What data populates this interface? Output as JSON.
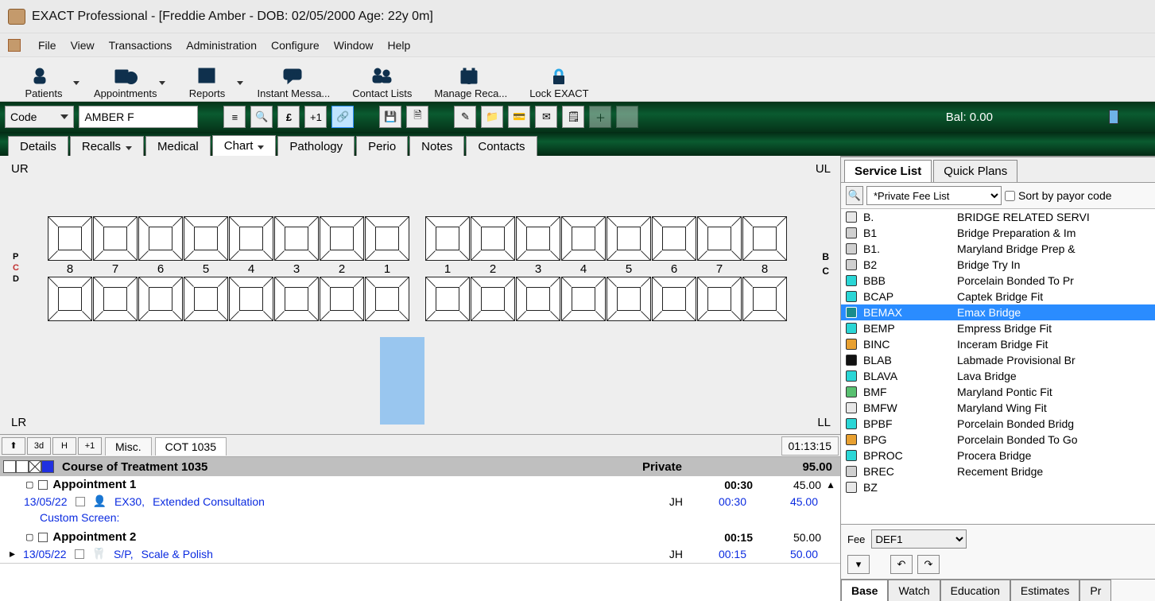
{
  "window": {
    "title": "EXACT Professional - [Freddie Amber - DOB: 02/05/2000 Age: 22y 0m]"
  },
  "menus": {
    "file": "File",
    "view": "View",
    "transactions": "Transactions",
    "administration": "Administration",
    "configure": "Configure",
    "window": "Window",
    "help": "Help"
  },
  "bigtoolbar": {
    "patients": "Patients",
    "appointments": "Appointments",
    "reports": "Reports",
    "instant": "Instant Messa...",
    "contactlists": "Contact Lists",
    "managerecalls": "Manage Reca...",
    "lockexact": "Lock EXACT"
  },
  "greenbar": {
    "codeLabel": "Code",
    "patientField": "AMBER F",
    "balance": "Bal: 0.00"
  },
  "tabs": {
    "details": "Details",
    "recalls": "Recalls",
    "medical": "Medical",
    "chart": "Chart",
    "pathology": "Pathology",
    "perio": "Perio",
    "notes": "Notes",
    "contacts": "Contacts"
  },
  "chart": {
    "ur": "UR",
    "ul": "UL",
    "lr": "LR",
    "ll": "LL",
    "p": "P",
    "c": "C",
    "d": "D",
    "b": "B",
    "c2": "C",
    "numsLeft": [
      "8",
      "7",
      "6",
      "5",
      "4",
      "3",
      "2",
      "1"
    ],
    "numsRight": [
      "1",
      "2",
      "3",
      "4",
      "5",
      "6",
      "7",
      "8"
    ]
  },
  "lower": {
    "nav": {
      "up": "⬆",
      "threeD": "3d",
      "h": "H",
      "plus1": "+1"
    },
    "tabs": {
      "misc": "Misc.",
      "cot": "COT 1035"
    },
    "timer": "01:13:15",
    "cot": {
      "title": "Course of Treatment 1035",
      "payor": "Private",
      "total": "95.00"
    },
    "appointments": [
      {
        "title": "Appointment 1",
        "duration": "00:30",
        "fee": "45.00",
        "line": {
          "date": "13/05/22",
          "code": "EX30,",
          "desc": "Extended Consultation",
          "provider": "JH",
          "time": "00:30",
          "amount": "45.00"
        },
        "custom": "Custom Screen:"
      },
      {
        "title": "Appointment 2",
        "duration": "00:15",
        "fee": "50.00",
        "line": {
          "date": "13/05/22",
          "code": "S/P,",
          "desc": "Scale & Polish",
          "provider": "JH",
          "time": "00:15",
          "amount": "50.00"
        }
      }
    ]
  },
  "right": {
    "tabs": {
      "service": "Service List",
      "quick": "Quick Plans"
    },
    "filter": {
      "list": "*Private Fee List",
      "sort": "Sort by payor code"
    },
    "services": [
      {
        "color": "#e8e8e8",
        "code": "B.",
        "desc": "BRIDGE RELATED SERVI",
        "heading": true
      },
      {
        "color": "#d0d0d0",
        "code": "B1",
        "desc": "Bridge Preparation & Im"
      },
      {
        "color": "#d0d0d0",
        "code": "B1.",
        "desc": "Maryland Bridge Prep &"
      },
      {
        "color": "#d0d0d0",
        "code": "B2",
        "desc": "Bridge Try In"
      },
      {
        "color": "#2ad6d6",
        "code": "BBB",
        "desc": "Porcelain Bonded To Pr"
      },
      {
        "color": "#2ad6d6",
        "code": "BCAP",
        "desc": "Captek Bridge Fit"
      },
      {
        "color": "#1a8c8c",
        "code": "BEMAX",
        "desc": "Emax Bridge",
        "selected": true
      },
      {
        "color": "#2ad6d6",
        "code": "BEMP",
        "desc": "Empress Bridge Fit"
      },
      {
        "color": "#e8a030",
        "code": "BINC",
        "desc": "Inceram Bridge Fit"
      },
      {
        "color": "#111111",
        "code": "BLAB",
        "desc": "Labmade Provisional Br"
      },
      {
        "color": "#2ad6d6",
        "code": "BLAVA",
        "desc": "Lava Bridge"
      },
      {
        "color": "#58c070",
        "code": "BMF",
        "desc": "Maryland Pontic Fit"
      },
      {
        "color": "#e8e8e8",
        "code": "BMFW",
        "desc": "Maryland Wing Fit"
      },
      {
        "color": "#2ad6d6",
        "code": "BPBF",
        "desc": "Porcelain Bonded Bridg"
      },
      {
        "color": "#e8a030",
        "code": "BPG",
        "desc": "Porcelain Bonded To Go"
      },
      {
        "color": "#2ad6d6",
        "code": "BPROC",
        "desc": "Procera Bridge"
      },
      {
        "color": "#d0d0d0",
        "code": "BREC",
        "desc": "Recement Bridge"
      },
      {
        "color": "#e8e8e8",
        "code": "BZ",
        "desc": ""
      }
    ],
    "feeLabel": "Fee",
    "feeValue": "DEF1",
    "bottomTabs": {
      "base": "Base",
      "watch": "Watch",
      "education": "Education",
      "estimates": "Estimates",
      "pr": "Pr"
    }
  }
}
